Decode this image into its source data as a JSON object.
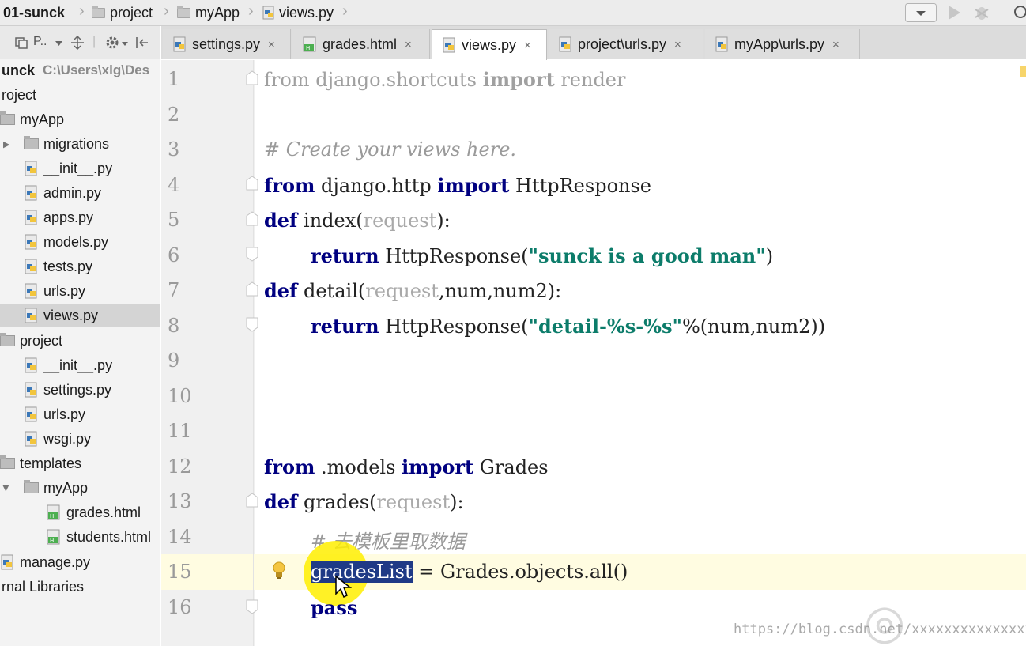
{
  "breadcrumb": {
    "items": [
      {
        "label": "01-sunck",
        "icon": "folder-icon"
      },
      {
        "label": "project",
        "icon": "folder-icon"
      },
      {
        "label": "myApp",
        "icon": "folder-icon"
      },
      {
        "label": "views.py",
        "icon": "python-file-icon"
      }
    ]
  },
  "project_panel": {
    "toolbar_label": "P..",
    "tree": [
      {
        "label": "unck",
        "hint": "C:\\Users\\xlg\\Des",
        "icon": "folder-icon"
      },
      {
        "label": "roject",
        "icon": "folder-icon"
      },
      {
        "label": "myApp",
        "icon": "folder-icon"
      },
      {
        "label": "migrations",
        "icon": "folder-icon"
      },
      {
        "label": "__init__.py",
        "icon": "python-file-icon"
      },
      {
        "label": "admin.py",
        "icon": "python-file-icon"
      },
      {
        "label": "apps.py",
        "icon": "python-file-icon"
      },
      {
        "label": "models.py",
        "icon": "python-file-icon"
      },
      {
        "label": "tests.py",
        "icon": "python-file-icon"
      },
      {
        "label": "urls.py",
        "icon": "python-file-icon"
      },
      {
        "label": "views.py",
        "icon": "python-file-icon",
        "selected": true
      },
      {
        "label": "project",
        "icon": "folder-icon"
      },
      {
        "label": "__init__.py",
        "icon": "python-file-icon"
      },
      {
        "label": "settings.py",
        "icon": "python-file-icon"
      },
      {
        "label": "urls.py",
        "icon": "python-file-icon"
      },
      {
        "label": "wsgi.py",
        "icon": "python-file-icon"
      },
      {
        "label": "templates",
        "icon": "folder-icon"
      },
      {
        "label": "myApp",
        "icon": "folder-icon"
      },
      {
        "label": "grades.html",
        "icon": "html-file-icon"
      },
      {
        "label": "students.html",
        "icon": "html-file-icon"
      },
      {
        "label": "manage.py",
        "icon": "python-file-icon"
      },
      {
        "label": "rnal Libraries",
        "icon": "library-icon"
      }
    ]
  },
  "tabs": [
    {
      "label": "settings.py",
      "icon": "python-file-icon",
      "active": false
    },
    {
      "label": "grades.html",
      "icon": "html-file-icon",
      "active": false
    },
    {
      "label": "views.py",
      "icon": "python-file-icon",
      "active": true
    },
    {
      "label": "project\\urls.py",
      "icon": "python-file-icon",
      "active": false
    },
    {
      "label": "myApp\\urls.py",
      "icon": "python-file-icon",
      "active": false
    }
  ],
  "tab_close": "×",
  "editor": {
    "line_numbers": [
      "1",
      "2",
      "3",
      "4",
      "5",
      "6",
      "7",
      "8",
      "9",
      "10",
      "11",
      "12",
      "13",
      "14",
      "15",
      "16"
    ],
    "code": {
      "l1": {
        "kw1": "from",
        "mod": "django.shortcuts",
        "kw2": "import",
        "name": "render"
      },
      "l3": {
        "comment": "# Create your views here."
      },
      "l4": {
        "kw1": "from",
        "mod": "django.http",
        "kw2": "import",
        "name": "HttpResponse"
      },
      "l5": {
        "kw": "def",
        "fn": "index",
        "open": "(",
        "param": "request",
        "close": "):"
      },
      "l6": {
        "kw": "return",
        "call": "HttpResponse(",
        "str": "\"sunck is a good man\"",
        "close": ")"
      },
      "l7": {
        "kw": "def",
        "fn": "detail",
        "open": "(",
        "param": "request",
        "rest": ",num,num2):"
      },
      "l8": {
        "kw": "return",
        "call": "HttpResponse(",
        "str": "\"detail-%s-%s\"",
        "rest": "%(num,num2))"
      },
      "l12": {
        "kw1": "from",
        "mod": ".models",
        "kw2": "import",
        "name": "Grades"
      },
      "l13": {
        "kw": "def",
        "fn": "grades",
        "open": "(",
        "param": "request",
        "close": "):"
      },
      "l14": {
        "comment": "# 去模板里取数据"
      },
      "l15": {
        "sel1": "grades",
        "sel2": "List",
        "rest": " = Grades.objects.all()"
      },
      "l16": {
        "kw": "pass"
      }
    }
  },
  "watermark": "https://blog.csdn.net/xxxxxxxxxxxxxxxxs",
  "colors": {
    "keyword": "#000080",
    "string": "#0c7c6a",
    "comment": "#9a9a9a",
    "selection": "#1f3a86",
    "current_line": "#fffce1"
  }
}
